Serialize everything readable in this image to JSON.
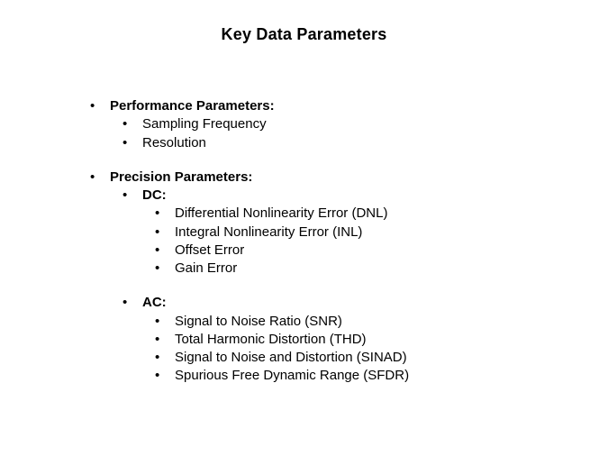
{
  "title": "Key Data Parameters",
  "sections": {
    "performance": {
      "heading": "Performance Parameters:",
      "items": [
        "Sampling Frequency",
        "Resolution"
      ]
    },
    "precision": {
      "heading": "Precision Parameters:",
      "dc": {
        "heading": "DC:",
        "items": [
          "Differential Nonlinearity Error (DNL)",
          "Integral Nonlinearity Error (INL)",
          "Offset Error",
          "Gain Error"
        ]
      },
      "ac": {
        "heading": "AC:",
        "items": [
          "Signal to Noise Ratio (SNR)",
          "Total Harmonic Distortion (THD)",
          "Signal to Noise and Distortion (SINAD)",
          "Spurious Free Dynamic Range (SFDR)"
        ]
      }
    }
  }
}
